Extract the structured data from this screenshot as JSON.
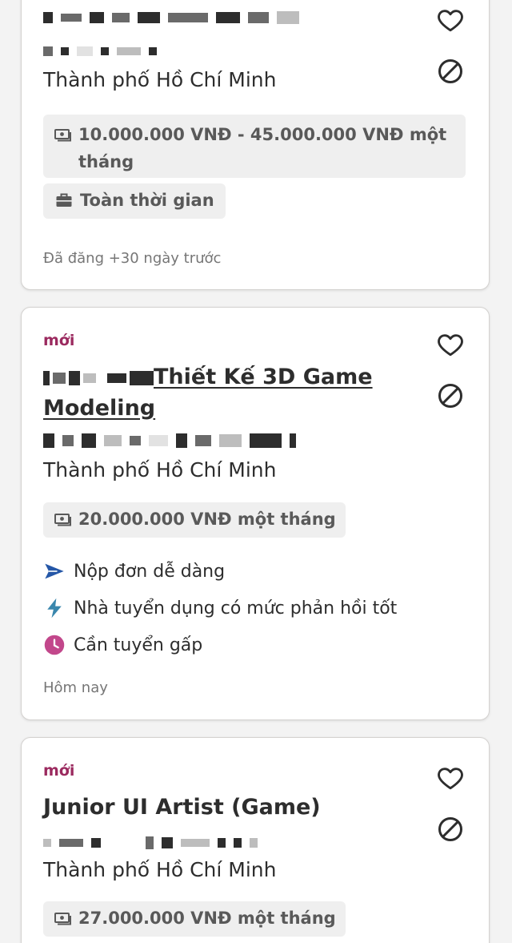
{
  "cards": [
    {
      "location": "Thành phố Hồ Chí Minh",
      "salary": "10.000.000 VNĐ - 45.000.000 VNĐ một tháng",
      "job_type": "Toàn thời gian",
      "posted": "Đã đăng +30 ngày trước"
    },
    {
      "badge": "mới",
      "title": "Thiết Kế 3D Game Modeling",
      "location": "Thành phố Hồ Chí Minh",
      "salary": "20.000.000 VNĐ một tháng",
      "features": [
        {
          "icon": "send-icon",
          "label": "Nộp đơn dễ dàng"
        },
        {
          "icon": "lightning-icon",
          "label": "Nhà tuyển dụng có mức phản hồi tốt"
        },
        {
          "icon": "clock-icon",
          "label": "Cần tuyển gấp"
        }
      ],
      "posted": "Hôm nay"
    },
    {
      "badge": "mới",
      "title": "Junior UI Artist (Game)",
      "location": "Thành phố Hồ Chí Minh",
      "salary": "27.000.000 VNĐ một tháng"
    }
  ],
  "colors": {
    "badge": "#9b2a5f",
    "send_icon": "#2557a7",
    "lightning_icon": "#3a87ad",
    "clock_icon": "#c2478b",
    "chip_bg": "#efefef"
  }
}
